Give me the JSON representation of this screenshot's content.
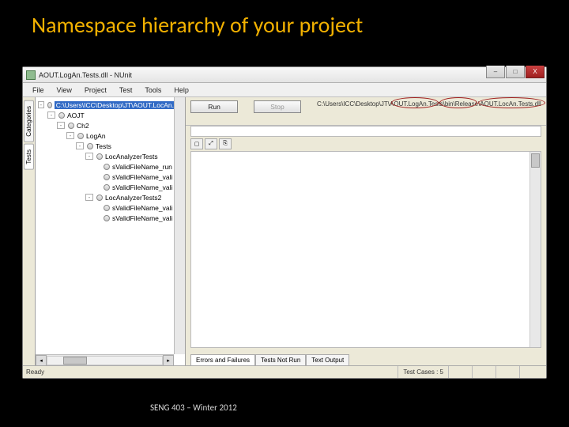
{
  "slide": {
    "title": "Namespace hierarchy of your project",
    "footer": "SENG 403 – Winter 2012"
  },
  "window": {
    "title": "AOUT.LogAn.Tests.dll - NUnit",
    "controls": {
      "min": "–",
      "max": "□",
      "close": "X"
    }
  },
  "menu": [
    "File",
    "View",
    "Project",
    "Test",
    "Tools",
    "Help"
  ],
  "left_tabs": {
    "categories": "Categories",
    "tests": "Tests"
  },
  "tree": {
    "root": "C:\\Users\\ICC\\Desktop\\JT\\AOUT.LocAn.Te",
    "nodes": [
      {
        "label": "AOJT",
        "indent": 1,
        "toggle": "-"
      },
      {
        "label": "Ch2",
        "indent": 2,
        "toggle": "-"
      },
      {
        "label": "LogAn",
        "indent": 3,
        "toggle": "-"
      },
      {
        "label": "Tests",
        "indent": 4,
        "toggle": "-"
      },
      {
        "label": "LocAnalyzerTests",
        "indent": 5,
        "toggle": "-"
      },
      {
        "label": "sValidFileName_run",
        "indent": 6
      },
      {
        "label": "sValidFileName_vali",
        "indent": 6
      },
      {
        "label": "sValidFileName_vali",
        "indent": 6
      },
      {
        "label": "LocAnalyzerTests2",
        "indent": 5,
        "toggle": "-"
      },
      {
        "label": "sValidFileName_vali",
        "indent": 6
      },
      {
        "label": "sValidFileName_vali",
        "indent": 6
      }
    ]
  },
  "buttons": {
    "run": "Run",
    "stop": "Stop"
  },
  "path_display": "C:\\Users\\ICC\\Desktop\\JT\\AOUT.LogAn.Tests\\bin\\Release\\AOUT.LocAn.Tests.dll",
  "bottom_tabs": {
    "errors": "Errors and Failures",
    "notrun": "Tests Not Run",
    "output": "Text Output"
  },
  "status": {
    "ready": "Ready",
    "cases": "Test Cases : 5"
  }
}
